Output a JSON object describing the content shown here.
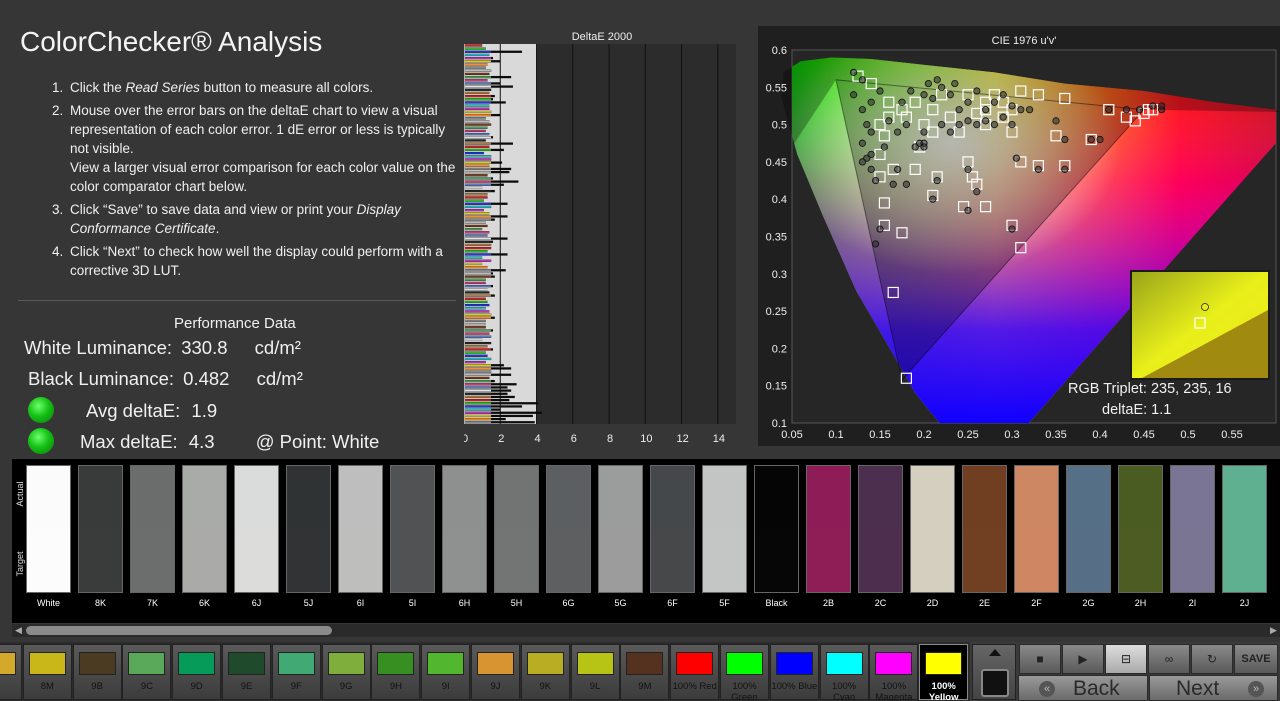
{
  "title": "ColorChecker® Analysis",
  "instructions": [
    {
      "num": "1.",
      "parts": [
        {
          "t": "Click the "
        },
        {
          "t": "Read Series",
          "i": true
        },
        {
          "t": " button to measure all colors."
        }
      ]
    },
    {
      "num": "2.",
      "parts": [
        {
          "t": "Mouse over the error bars on the deltaE chart to view a visual representation of each color error. 1 dE error or less is typically not visible."
        },
        {
          "br": true
        },
        {
          "t": "View a larger visual error comparison for each color value on the color comparator chart below."
        }
      ]
    },
    {
      "num": "3.",
      "parts": [
        {
          "t": "Click “Save” to save data and view or print your "
        },
        {
          "t": "Display Conformance Certificate",
          "i": true
        },
        {
          "t": "."
        }
      ]
    },
    {
      "num": "4.",
      "parts": [
        {
          "t": "Click “Next” to check how well the display could perform with a corrective 3D LUT."
        }
      ]
    }
  ],
  "performance": {
    "title": "Performance Data",
    "white_label": "White Luminance:",
    "white_value": "330.8",
    "white_unit": "cd/m²",
    "black_label": "Black Luminance:",
    "black_value": "0.482",
    "black_unit": "cd/m²",
    "avg_label": "Avg deltaE:",
    "avg_value": "1.9",
    "max_label": "Max deltaE:",
    "max_value": "4.3",
    "point_label": "@ Point: White",
    "status_color": "#14c214"
  },
  "chart_data": [
    {
      "type": "bar",
      "orientation": "horizontal",
      "title": "DeltaE 2000",
      "xlim": [
        0,
        15
      ],
      "xticks": [
        "0",
        "2",
        "4",
        "6",
        "8",
        "10",
        "12",
        "14"
      ],
      "values": [
        1.0,
        1.2,
        3.2,
        1.4,
        1.6,
        2.0,
        1.3,
        1.2,
        1.5,
        1.4,
        2.6,
        1.3,
        2.0,
        2.7,
        1.5,
        1.4,
        1.7,
        1.6,
        2.3,
        1.4,
        1.4,
        1.5,
        2.0,
        1.2,
        1.4,
        1.5,
        1.3,
        1.2,
        1.4,
        1.6,
        1.2,
        2.7,
        1.4,
        2.2,
        1.1,
        1.5,
        1.5,
        2.1,
        1.4,
        2.6,
        2.5,
        1.3,
        1.6,
        3.0,
        2.2,
        1.0,
        1.7,
        1.3,
        1.3,
        1.1,
        2.4,
        1.5,
        1.1,
        1.4,
        2.4,
        1.7,
        1.2,
        1.3,
        1.0,
        1.4,
        1.3,
        2.4,
        1.6,
        1.5,
        1.5,
        1.3,
        2.4,
        1.0,
        1.5,
        1.0,
        1.3,
        2.3,
        1.6,
        1.7,
        1.2,
        1.2,
        1.6,
        1.3,
        1.4,
        1.7,
        1.2,
        1.3,
        1.4,
        1.2,
        1.4,
        1.5,
        1.7,
        1.2,
        1.2,
        1.2,
        1.6,
        1.4,
        1.5,
        1.0,
        1.5,
        1.3,
        1.6,
        1.2,
        1.3,
        1.5,
        1.2,
        2.2,
        2.6,
        1.5,
        2.6,
        1.4,
        1.7,
        2.9,
        2.4,
        2.6,
        2.4,
        2.8,
        2.5,
        4.1,
        3.2,
        2.0,
        4.3,
        3.8,
        2.3,
        3.9
      ]
    },
    {
      "type": "scatter",
      "title": "CIE 1976 u'v'",
      "xlim": [
        0.05,
        0.6
      ],
      "ylim": [
        0.1,
        0.6
      ],
      "xticks": [
        "0.05",
        "0.1",
        "0.15",
        "0.2",
        "0.25",
        "0.3",
        "0.35",
        "0.4",
        "0.45",
        "0.5",
        "0.55"
      ],
      "yticks": [
        "0.1",
        "0.15",
        "0.2",
        "0.25",
        "0.3",
        "0.35",
        "0.4",
        "0.45",
        "0.5",
        "0.55",
        "0.6"
      ],
      "gamut": [
        [
          0.45,
          0.52
        ],
        [
          0.175,
          0.158
        ],
        [
          0.1,
          0.56
        ]
      ],
      "targets": [
        [
          0.125,
          0.565
        ],
        [
          0.14,
          0.555
        ],
        [
          0.16,
          0.53
        ],
        [
          0.16,
          0.51
        ],
        [
          0.15,
          0.5
        ],
        [
          0.155,
          0.485
        ],
        [
          0.15,
          0.46
        ],
        [
          0.15,
          0.43
        ],
        [
          0.165,
          0.44
        ],
        [
          0.19,
          0.44
        ],
        [
          0.195,
          0.47
        ],
        [
          0.175,
          0.355
        ],
        [
          0.155,
          0.395
        ],
        [
          0.155,
          0.365
        ],
        [
          0.165,
          0.275
        ],
        [
          0.18,
          0.16
        ],
        [
          0.215,
          0.43
        ],
        [
          0.21,
          0.405
        ],
        [
          0.25,
          0.45
        ],
        [
          0.26,
          0.42
        ],
        [
          0.245,
          0.39
        ],
        [
          0.255,
          0.43
        ],
        [
          0.27,
          0.39
        ],
        [
          0.3,
          0.365
        ],
        [
          0.31,
          0.335
        ],
        [
          0.31,
          0.45
        ],
        [
          0.33,
          0.445
        ],
        [
          0.36,
          0.445
        ],
        [
          0.35,
          0.485
        ],
        [
          0.39,
          0.48
        ],
        [
          0.3,
          0.49
        ],
        [
          0.27,
          0.5
        ],
        [
          0.25,
          0.54
        ],
        [
          0.27,
          0.52
        ],
        [
          0.29,
          0.53
        ],
        [
          0.31,
          0.545
        ],
        [
          0.33,
          0.54
        ],
        [
          0.36,
          0.535
        ],
        [
          0.41,
          0.52
        ],
        [
          0.43,
          0.51
        ],
        [
          0.44,
          0.505
        ],
        [
          0.45,
          0.515
        ],
        [
          0.455,
          0.52
        ],
        [
          0.46,
          0.52
        ],
        [
          0.21,
          0.52
        ],
        [
          0.23,
          0.51
        ],
        [
          0.2,
          0.5
        ],
        [
          0.18,
          0.51
        ],
        [
          0.24,
          0.49
        ],
        [
          0.22,
          0.54
        ],
        [
          0.19,
          0.53
        ],
        [
          0.175,
          0.52
        ],
        [
          0.27,
          0.53
        ],
        [
          0.3,
          0.52
        ],
        [
          0.28,
          0.54
        ],
        [
          0.26,
          0.515
        ],
        [
          0.29,
          0.51
        ],
        [
          0.21,
          0.49
        ],
        [
          0.195,
          0.47
        ]
      ],
      "measured": [
        [
          0.12,
          0.57
        ],
        [
          0.13,
          0.56
        ],
        [
          0.12,
          0.54
        ],
        [
          0.15,
          0.545
        ],
        [
          0.14,
          0.53
        ],
        [
          0.13,
          0.52
        ],
        [
          0.135,
          0.5
        ],
        [
          0.14,
          0.49
        ],
        [
          0.13,
          0.475
        ],
        [
          0.135,
          0.455
        ],
        [
          0.14,
          0.44
        ],
        [
          0.145,
          0.425
        ],
        [
          0.165,
          0.42
        ],
        [
          0.17,
          0.44
        ],
        [
          0.18,
          0.42
        ],
        [
          0.19,
          0.47
        ],
        [
          0.195,
          0.475
        ],
        [
          0.15,
          0.36
        ],
        [
          0.145,
          0.34
        ],
        [
          0.21,
          0.4
        ],
        [
          0.215,
          0.425
        ],
        [
          0.25,
          0.44
        ],
        [
          0.26,
          0.41
        ],
        [
          0.25,
          0.385
        ],
        [
          0.3,
          0.36
        ],
        [
          0.305,
          0.455
        ],
        [
          0.33,
          0.44
        ],
        [
          0.36,
          0.44
        ],
        [
          0.36,
          0.48
        ],
        [
          0.35,
          0.505
        ],
        [
          0.39,
          0.48
        ],
        [
          0.4,
          0.48
        ],
        [
          0.41,
          0.52
        ],
        [
          0.43,
          0.52
        ],
        [
          0.445,
          0.52
        ],
        [
          0.46,
          0.525
        ],
        [
          0.47,
          0.52
        ],
        [
          0.47,
          0.525
        ],
        [
          0.2,
          0.54
        ],
        [
          0.21,
          0.535
        ],
        [
          0.22,
          0.55
        ],
        [
          0.23,
          0.54
        ],
        [
          0.24,
          0.52
        ],
        [
          0.25,
          0.53
        ],
        [
          0.26,
          0.545
        ],
        [
          0.27,
          0.52
        ],
        [
          0.28,
          0.53
        ],
        [
          0.29,
          0.54
        ],
        [
          0.3,
          0.525
        ],
        [
          0.3,
          0.5
        ],
        [
          0.31,
          0.52
        ],
        [
          0.32,
          0.52
        ],
        [
          0.27,
          0.505
        ],
        [
          0.26,
          0.5
        ],
        [
          0.24,
          0.5
        ],
        [
          0.22,
          0.5
        ],
        [
          0.2,
          0.49
        ],
        [
          0.18,
          0.5
        ],
        [
          0.17,
          0.49
        ],
        [
          0.16,
          0.505
        ],
        [
          0.175,
          0.53
        ],
        [
          0.185,
          0.545
        ],
        [
          0.205,
          0.555
        ],
        [
          0.215,
          0.56
        ],
        [
          0.235,
          0.555
        ],
        [
          0.155,
          0.47
        ],
        [
          0.14,
          0.46
        ],
        [
          0.13,
          0.45
        ],
        [
          0.29,
          0.51
        ],
        [
          0.28,
          0.5
        ],
        [
          0.25,
          0.505
        ],
        [
          0.23,
          0.49
        ],
        [
          0.2,
          0.475
        ],
        [
          0.2,
          0.47
        ]
      ]
    }
  ],
  "inset": {
    "rgb_triplet": "RGB Triplet: 235, 235, 16",
    "delta": "deltaE: 1.1"
  },
  "comparator": {
    "actual_label": "Actual",
    "target_label": "Target",
    "swatches": [
      {
        "label": "White",
        "actual": "#fbfbfb",
        "target": "#fcfcfc"
      },
      {
        "label": "8K",
        "actual": "#393b3b",
        "target": "#3a3b3b"
      },
      {
        "label": "7K",
        "actual": "#6b6d6d",
        "target": "#6c6d6d"
      },
      {
        "label": "6K",
        "actual": "#a9aba9",
        "target": "#aaaba9"
      },
      {
        "label": "6J",
        "actual": "#dadcdb",
        "target": "#dcdcdb"
      },
      {
        "label": "5J",
        "actual": "#303334",
        "target": "#313334"
      },
      {
        "label": "6I",
        "actual": "#bdbebd",
        "target": "#bebebd"
      },
      {
        "label": "5I",
        "actual": "#505254",
        "target": "#515254"
      },
      {
        "label": "6H",
        "actual": "#8e9090",
        "target": "#8f9090"
      },
      {
        "label": "5H",
        "actual": "#727474",
        "target": "#737474"
      },
      {
        "label": "6G",
        "actual": "#5c5f61",
        "target": "#5d5f61"
      },
      {
        "label": "5G",
        "actual": "#9b9c9c",
        "target": "#9c9c9c"
      },
      {
        "label": "6F",
        "actual": "#45484a",
        "target": "#46484a"
      },
      {
        "label": "5F",
        "actual": "#c3c5c5",
        "target": "#c4c5c5"
      },
      {
        "label": "Black",
        "actual": "#050505",
        "target": "#060606"
      },
      {
        "label": "2B",
        "actual": "#8e1d57",
        "target": "#8f1e57"
      },
      {
        "label": "2C",
        "actual": "#4c2e4f",
        "target": "#4d2e4f"
      },
      {
        "label": "2D",
        "actual": "#d4cfbf",
        "target": "#d5cfbf"
      },
      {
        "label": "2E",
        "actual": "#703f22",
        "target": "#713f22"
      },
      {
        "label": "2F",
        "actual": "#cd8762",
        "target": "#ce8762"
      },
      {
        "label": "2G",
        "actual": "#556f86",
        "target": "#566f86"
      },
      {
        "label": "2H",
        "actual": "#4b5c22",
        "target": "#4c5c22"
      },
      {
        "label": "2I",
        "actual": "#7a7594",
        "target": "#7b7594"
      },
      {
        "label": "2J",
        "actual": "#5eb090",
        "target": "#5fb090"
      }
    ]
  },
  "patches": [
    {
      "label": "",
      "color": "#d4a82a"
    },
    {
      "label": "8M",
      "color": "#c9b71a"
    },
    {
      "label": "9B",
      "color": "#4a3b22"
    },
    {
      "label": "9C",
      "color": "#5aa95a"
    },
    {
      "label": "9D",
      "color": "#079b5a"
    },
    {
      "label": "9E",
      "color": "#1f4a2c"
    },
    {
      "label": "9F",
      "color": "#41aa74"
    },
    {
      "label": "9G",
      "color": "#7fae3c"
    },
    {
      "label": "9H",
      "color": "#368f20"
    },
    {
      "label": "9I",
      "color": "#52b62f"
    },
    {
      "label": "9J",
      "color": "#d89431"
    },
    {
      "label": "9K",
      "color": "#b9ad24"
    },
    {
      "label": "9L",
      "color": "#b8c415"
    },
    {
      "label": "9M",
      "color": "#55311f"
    },
    {
      "label": "100% Red",
      "color": "#ff0000"
    },
    {
      "label": "100% Green",
      "color": "#00ff00"
    },
    {
      "label": "100% Blue",
      "color": "#0000ff"
    },
    {
      "label": "100% Cyan",
      "color": "#00ffff"
    },
    {
      "label": "100% Magenta",
      "color": "#ff00ff"
    },
    {
      "label": "100% Yellow",
      "color": "#ffff00",
      "selected": true
    }
  ],
  "controls": {
    "save": "SAVE",
    "back": "Back",
    "next": "Next",
    "back_arrow": "«",
    "next_arrow": "»",
    "stop_glyph": "■",
    "play_glyph": "▶",
    "loop_glyph": "∞",
    "refresh_glyph": "↻"
  }
}
